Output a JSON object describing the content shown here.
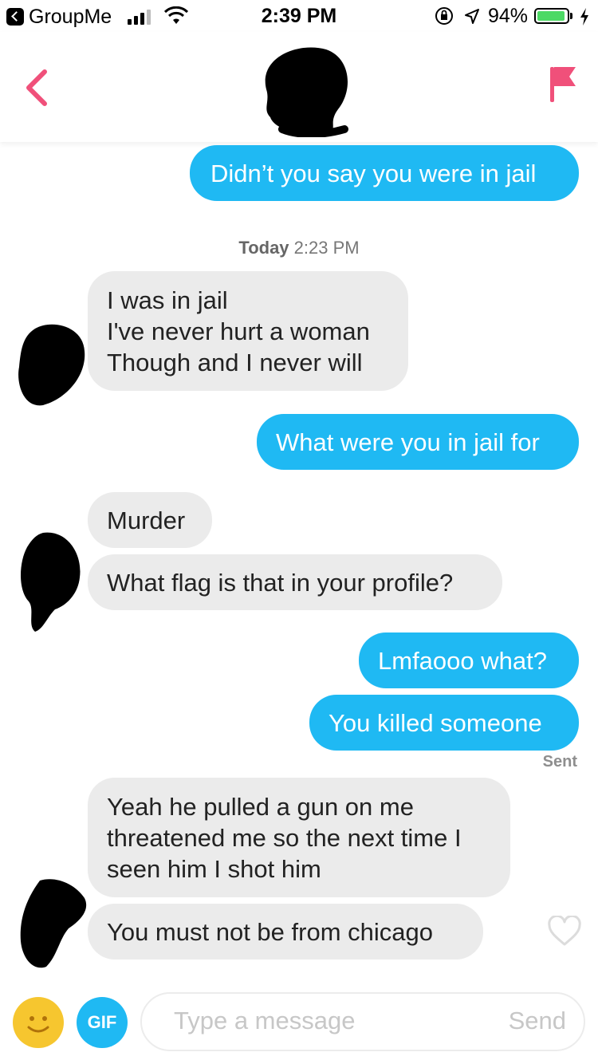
{
  "status_bar": {
    "back_app": "GroupMe",
    "time": "2:39 PM",
    "battery_percent": "94%",
    "battery_level": 0.94
  },
  "header": {
    "back_icon": "chevron-left-icon",
    "flag_icon": "flag-icon",
    "accent_color": "#f0507a"
  },
  "thread": {
    "messages": [
      {
        "side": "out",
        "lines": [
          "Didn’t you say you were in jail"
        ]
      },
      {
        "side": "in",
        "lines": [
          "I was in jail",
          "I've never hurt a woman",
          "Though and I never will"
        ]
      },
      {
        "side": "out",
        "lines": [
          "What were you in jail for"
        ]
      },
      {
        "side": "in",
        "lines": [
          "Murder"
        ]
      },
      {
        "side": "in",
        "lines": [
          "What flag is that in your profile?"
        ]
      },
      {
        "side": "out",
        "lines": [
          "Lmfaooo what?"
        ]
      },
      {
        "side": "out",
        "lines": [
          "You killed someone"
        ]
      },
      {
        "side": "in",
        "lines": [
          "Yeah he pulled a gun on me",
          "threatened me so the next time I",
          "seen him I shot him"
        ]
      },
      {
        "side": "in",
        "lines": [
          "You must not be from chicago"
        ]
      }
    ],
    "date_label_day": "Today",
    "date_label_time": "2:23 PM",
    "sent_label": "Sent"
  },
  "composer": {
    "gif_label": "GIF",
    "placeholder": "Type a message",
    "send_label": "Send"
  },
  "colors": {
    "outgoing_bubble": "#1fb9f3",
    "incoming_bubble": "#ebebeb",
    "emoji_button": "#f6c62f"
  }
}
